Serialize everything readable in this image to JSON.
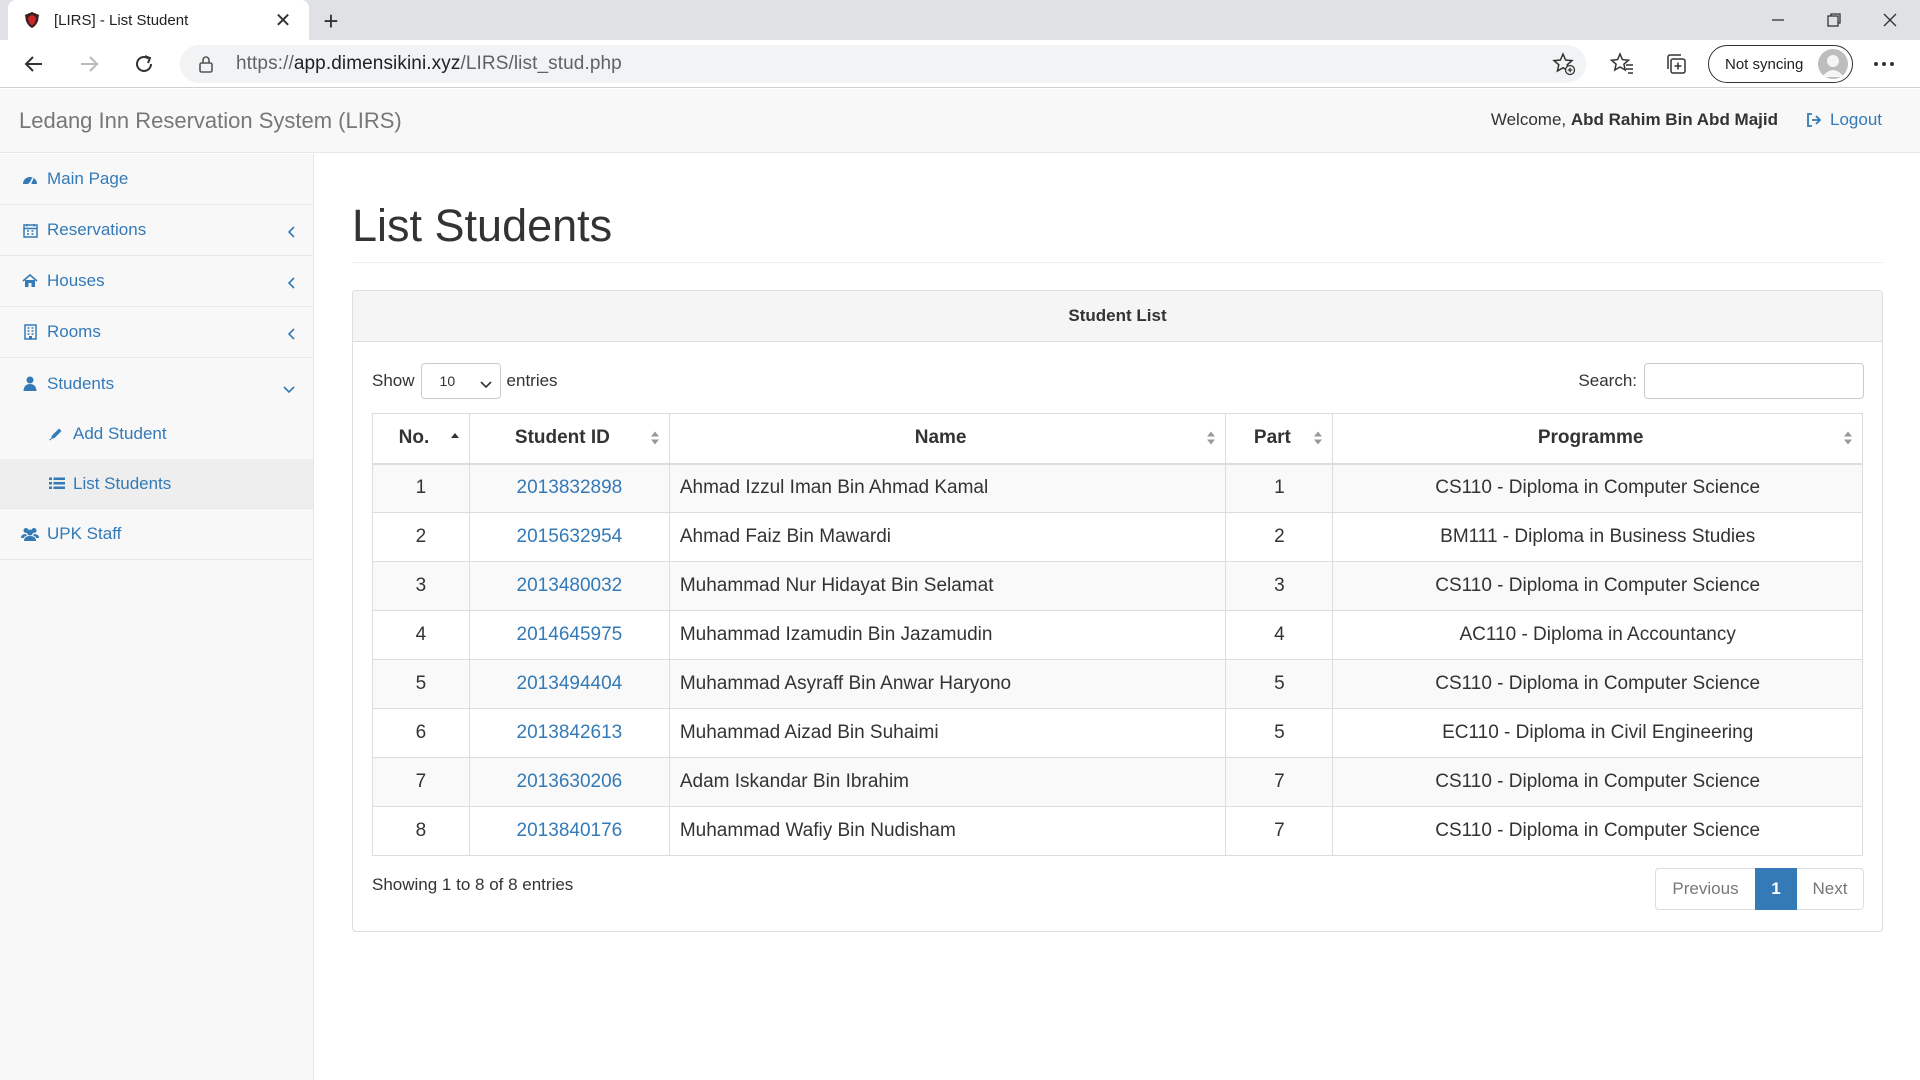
{
  "browser": {
    "tab_title": "[LIRS] - List Student",
    "url_prefix": "https://",
    "url_host": "app.dimensikini.xyz",
    "url_path": "/LIRS/list_stud.php",
    "sync_label": "Not syncing"
  },
  "header": {
    "brand": "Ledang Inn Reservation System (LIRS)",
    "welcome_prefix": "Welcome,",
    "user_name": "Abd Rahim Bin Abd Majid",
    "logout_label": "Logout"
  },
  "sidebar": {
    "items": [
      {
        "label": "Main Page",
        "icon": "dashboard-icon"
      },
      {
        "label": "Reservations",
        "icon": "calendar-icon"
      },
      {
        "label": "Houses",
        "icon": "home-icon"
      },
      {
        "label": "Rooms",
        "icon": "building-icon"
      },
      {
        "label": "Students",
        "icon": "user-icon"
      },
      {
        "label": "UPK Staff",
        "icon": "users-icon"
      }
    ],
    "sub_items": [
      {
        "label": "Add Student",
        "icon": "pencil-icon"
      },
      {
        "label": "List Students",
        "icon": "list-icon"
      }
    ]
  },
  "main": {
    "title": "List Students",
    "panel_title": "Student List",
    "show_label": "Show",
    "entries_label": "entries",
    "page_length": "10",
    "search_label": "Search:",
    "search_value": "",
    "columns": [
      "No.",
      "Student ID",
      "Name",
      "Part",
      "Programme"
    ],
    "rows": [
      {
        "no": "1",
        "id": "2013832898",
        "name": "Ahmad Izzul Iman Bin Ahmad Kamal",
        "part": "1",
        "programme": "CS110 - Diploma in Computer Science"
      },
      {
        "no": "2",
        "id": "2015632954",
        "name": "Ahmad Faiz Bin Mawardi",
        "part": "2",
        "programme": "BM111 - Diploma in Business Studies"
      },
      {
        "no": "3",
        "id": "2013480032",
        "name": "Muhammad Nur Hidayat Bin Selamat",
        "part": "3",
        "programme": "CS110 - Diploma in Computer Science"
      },
      {
        "no": "4",
        "id": "2014645975",
        "name": "Muhammad Izamudin Bin Jazamudin",
        "part": "4",
        "programme": "AC110 - Diploma in Accountancy"
      },
      {
        "no": "5",
        "id": "2013494404",
        "name": "Muhammad Asyraff Bin Anwar Haryono",
        "part": "5",
        "programme": "CS110 - Diploma in Computer Science"
      },
      {
        "no": "6",
        "id": "2013842613",
        "name": "Muhammad Aizad Bin Suhaimi",
        "part": "5",
        "programme": "EC110 - Diploma in Civil Engineering"
      },
      {
        "no": "7",
        "id": "2013630206",
        "name": "Adam Iskandar Bin Ibrahim",
        "part": "7",
        "programme": "CS110 - Diploma in Computer Science"
      },
      {
        "no": "8",
        "id": "2013840176",
        "name": "Muhammad Wafiy Bin Nudisham",
        "part": "7",
        "programme": "CS110 - Diploma in Computer Science"
      }
    ],
    "info": "Showing 1 to 8 of 8 entries",
    "pager": {
      "prev": "Previous",
      "current": "1",
      "next": "Next"
    }
  },
  "colors": {
    "link": "#337ab7",
    "bg_bar": "#f8f8f8",
    "border": "#ddd"
  }
}
